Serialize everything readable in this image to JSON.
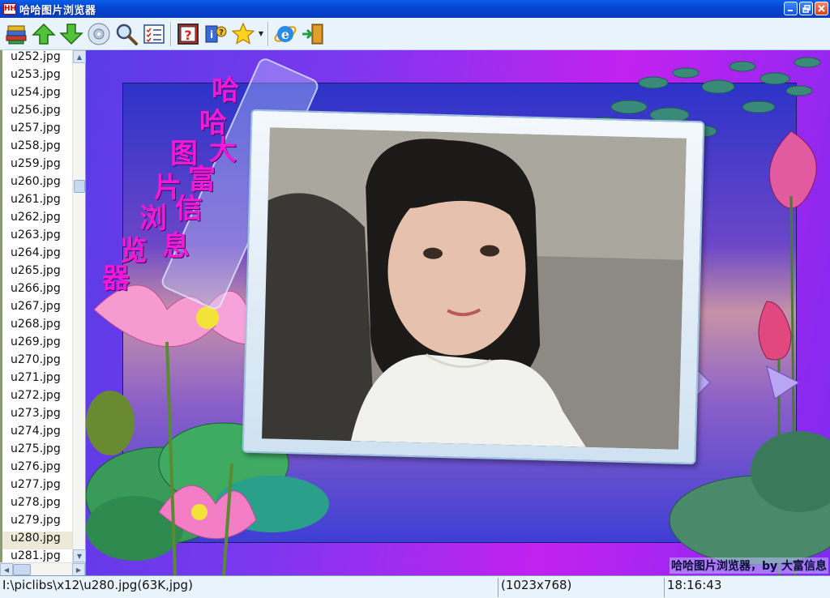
{
  "window": {
    "title": "哈哈图片浏览器",
    "app_icon": "app-logo-icon",
    "buttons": [
      "minimize",
      "maximize",
      "close"
    ]
  },
  "toolbar": {
    "buttons": [
      {
        "icon": "open-folder-books-icon"
      },
      {
        "icon": "arrow-up-icon"
      },
      {
        "icon": "arrow-down-icon"
      },
      {
        "icon": "cd-disc-icon"
      },
      {
        "icon": "magnifier-icon"
      },
      {
        "icon": "checklist-icon"
      },
      {
        "icon": "help-question-icon"
      },
      {
        "icon": "about-info-icon"
      },
      {
        "icon": "favorite-star-icon"
      },
      {
        "icon": "internet-explorer-icon"
      },
      {
        "icon": "exit-door-icon"
      }
    ]
  },
  "filelist": {
    "items": [
      "u252.jpg",
      "u253.jpg",
      "u254.jpg",
      "u256.jpg",
      "u257.jpg",
      "u258.jpg",
      "u259.jpg",
      "u260.jpg",
      "u261.jpg",
      "u262.jpg",
      "u263.jpg",
      "u264.jpg",
      "u265.jpg",
      "u266.jpg",
      "u267.jpg",
      "u268.jpg",
      "u269.jpg",
      "u270.jpg",
      "u271.jpg",
      "u272.jpg",
      "u273.jpg",
      "u274.jpg",
      "u275.jpg",
      "u276.jpg",
      "u277.jpg",
      "u278.jpg",
      "u279.jpg",
      "u280.jpg",
      "u281.jpg"
    ],
    "selected": "u280.jpg"
  },
  "viewer": {
    "banner_text": [
      "哈",
      "哈",
      "大",
      "图",
      "富",
      "片",
      "信",
      "浏",
      "息",
      "览",
      "器"
    ],
    "credit": "哈哈图片浏览器，by 大富信息"
  },
  "status": {
    "path": "I:\\piclibs\\x12\\u280.jpg(63K,jpg)",
    "dimensions": "(1023x768)",
    "time": "18:16:43"
  },
  "colors": {
    "banner_text": "#f418d8",
    "titlebar": "#0546d1",
    "toolbar_bg": "#e9f3fb"
  }
}
